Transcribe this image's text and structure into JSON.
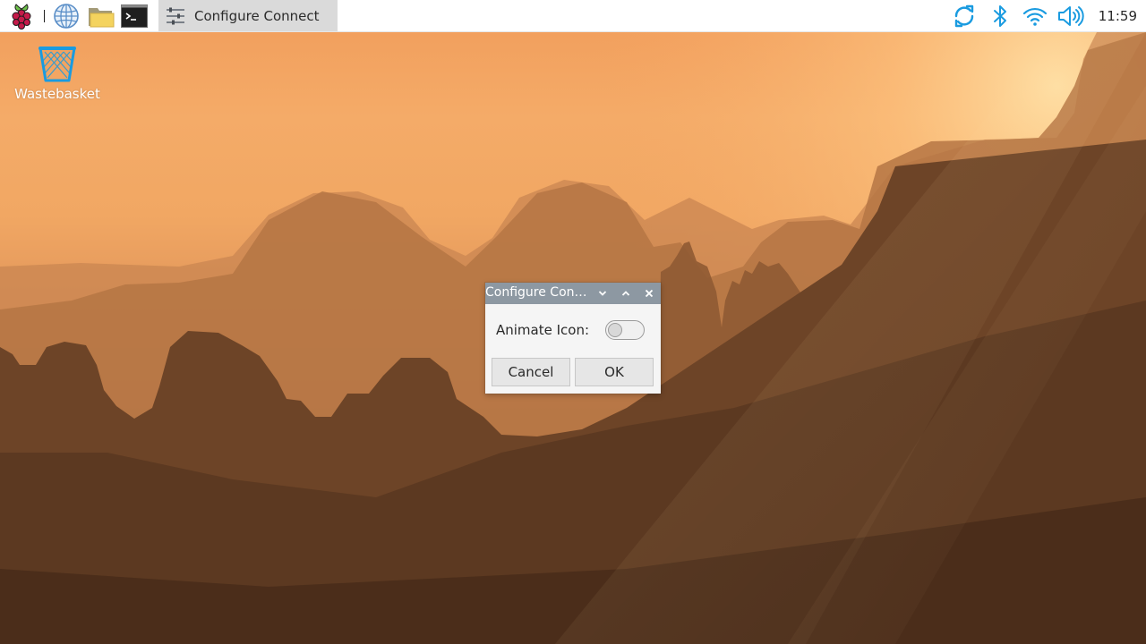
{
  "taskbar": {
    "launchers": [
      {
        "name": "raspberry-menu",
        "icon": "raspberry-pi-logo-icon"
      },
      {
        "name": "web-browser",
        "icon": "globe-icon"
      },
      {
        "name": "file-manager",
        "icon": "folder-icon"
      },
      {
        "name": "terminal",
        "icon": "terminal-icon"
      }
    ],
    "task": {
      "label": "Configure Connect",
      "icon": "settings-sliders-icon",
      "active": true
    },
    "tray": [
      {
        "name": "connect",
        "icon": "sync-arrows-icon",
        "color": "#1a9be0"
      },
      {
        "name": "bluetooth",
        "icon": "bluetooth-icon",
        "color": "#1a9be0"
      },
      {
        "name": "wifi",
        "icon": "wifi-icon",
        "color": "#1a9be0"
      },
      {
        "name": "volume",
        "icon": "speaker-icon",
        "color": "#1a9be0"
      }
    ],
    "clock": "11:59"
  },
  "desktop": {
    "icons": [
      {
        "label": "Wastebasket",
        "icon": "trash-can-icon"
      }
    ]
  },
  "dialog": {
    "title": "Configure Connect",
    "controls": [
      "minimize",
      "maximize",
      "close"
    ],
    "option_label": "Animate Icon:",
    "toggle_on": false,
    "cancel_label": "Cancel",
    "ok_label": "OK"
  },
  "colors": {
    "accent": "#1a9be0",
    "title_bar": "#8d98a2",
    "raspberry_red": "#c51a4a",
    "raspberry_leaf": "#6cc04a"
  }
}
